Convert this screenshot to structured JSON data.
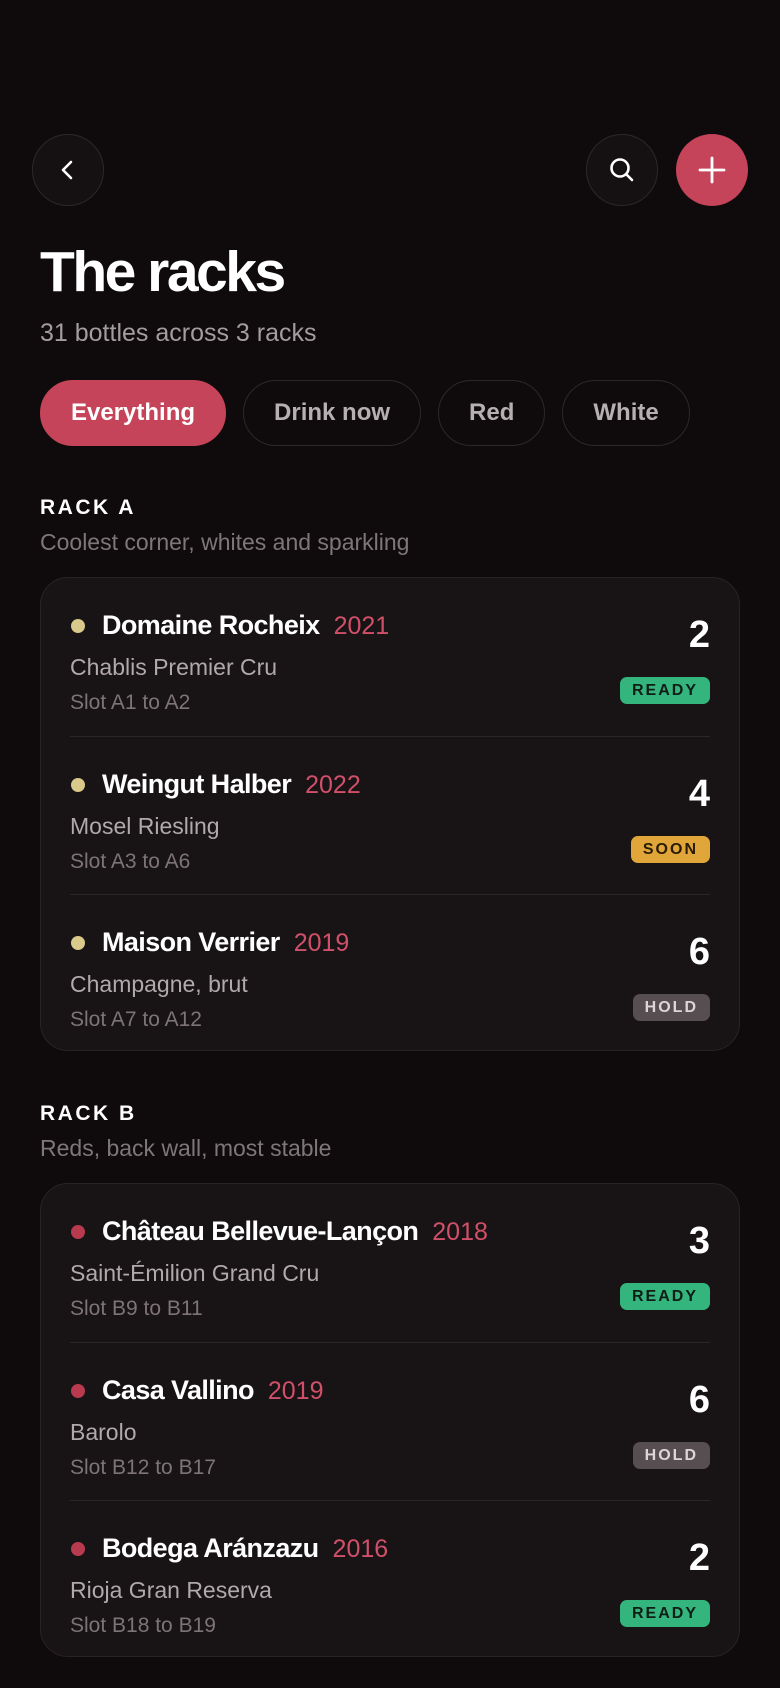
{
  "header": {
    "title": "The racks",
    "subtitle": "31 bottles across 3 racks"
  },
  "filters": [
    "Everything",
    "Drink now",
    "Red",
    "White"
  ],
  "racks": [
    {
      "heading": "RACK A",
      "description": "Coolest corner, whites and sparkling",
      "wines": [
        {
          "producer": "Domaine Rocheix",
          "vintage": "2021",
          "appellation": "Chablis Premier Cru",
          "slot": "Slot A1 to A2",
          "count": "2",
          "status": "READY",
          "type": "white"
        },
        {
          "producer": "Weingut Halber",
          "vintage": "2022",
          "appellation": "Mosel Riesling",
          "slot": "Slot A3 to A6",
          "count": "4",
          "status": "SOON",
          "type": "white"
        },
        {
          "producer": "Maison Verrier",
          "vintage": "2019",
          "appellation": "Champagne, brut",
          "slot": "Slot A7 to A12",
          "count": "6",
          "status": "HOLD",
          "type": "white"
        }
      ]
    },
    {
      "heading": "RACK B",
      "description": "Reds, back wall, most stable",
      "wines": [
        {
          "producer": "Château Bellevue-Lançon",
          "vintage": "2018",
          "appellation": "Saint-Émilion Grand Cru",
          "slot": "Slot B9 to B11",
          "count": "3",
          "status": "READY",
          "type": "red"
        },
        {
          "producer": "Casa Vallino",
          "vintage": "2019",
          "appellation": "Barolo",
          "slot": "Slot B12 to B17",
          "count": "6",
          "status": "HOLD",
          "type": "red"
        },
        {
          "producer": "Bodega Aránzazu",
          "vintage": "2016",
          "appellation": "Rioja Gran Reserva",
          "slot": "Slot B18 to B19",
          "count": "2",
          "status": "READY",
          "type": "red"
        }
      ]
    }
  ],
  "colors": {
    "accent": "#c54459",
    "ready": "#33b57d",
    "soon": "#e0a63a",
    "hold": "#564e51",
    "white_wine_dot": "#d9c98a",
    "red_wine_dot": "#b73a4e"
  },
  "icons": {
    "back": "chevron-left-icon",
    "search": "search-icon",
    "add": "plus-icon"
  }
}
